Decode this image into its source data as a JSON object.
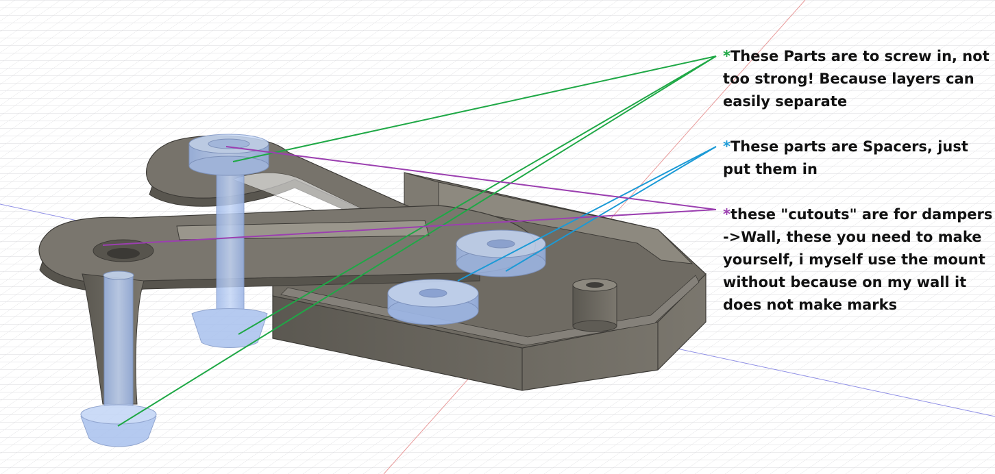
{
  "annotations": {
    "screws": {
      "marker": "*",
      "text": "These Parts are to screw in, not too strong! Because layers can easily separate"
    },
    "spacers": {
      "marker": "*",
      "text": "These parts are Spacers, just put them in"
    },
    "cutouts": {
      "marker": "*",
      "text": "these \"cutouts\" are for dampers ->Wall, these you need to make yourself, i myself use the mount without because on my wall it does not make marks"
    }
  },
  "colors": {
    "screws_leader": "#1fa846",
    "spacers_leader": "#1b9ad6",
    "cutouts_leader": "#9b3fb0",
    "part_body": "#6e6a62",
    "transparent_part": "#a9c4ef",
    "grid_line": "#d4d4d8",
    "background": "#ffffff"
  }
}
